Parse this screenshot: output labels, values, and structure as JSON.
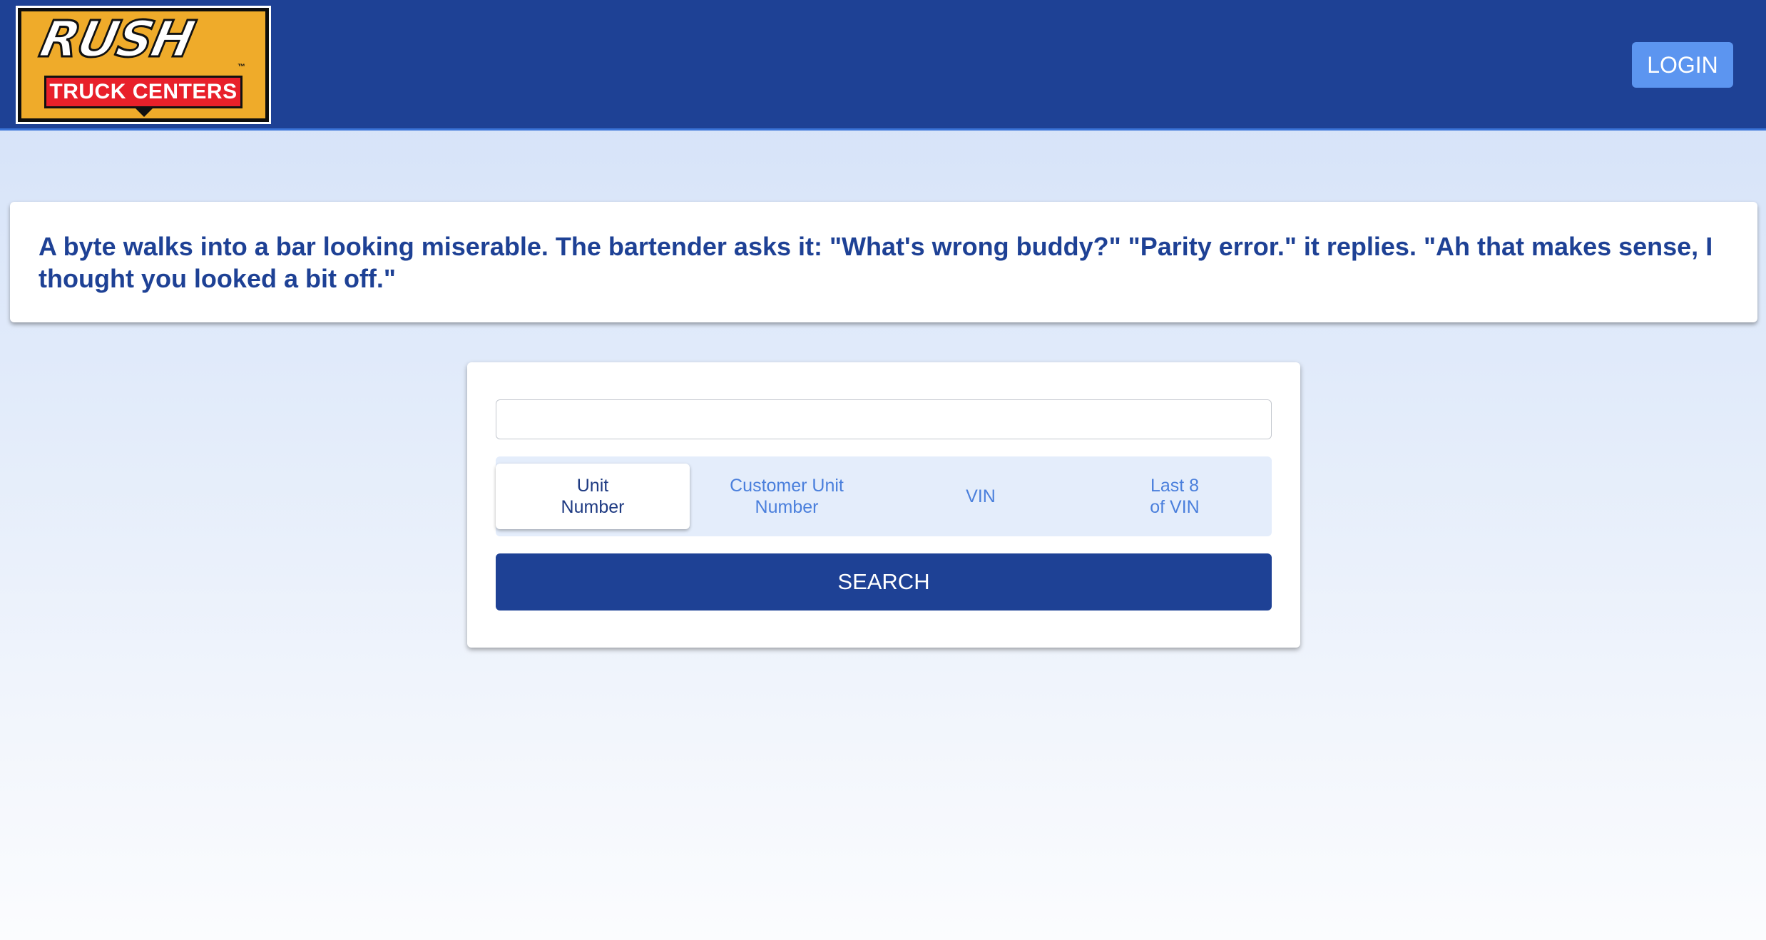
{
  "header": {
    "logo": {
      "brand_word": "RUSH",
      "trademark": "™",
      "band_text": "TRUCK CENTERS"
    },
    "login_label": "LOGIN"
  },
  "banner": {
    "text": "A byte walks into a bar looking miserable. The bartender asks it: \"What's wrong buddy?\" \"Parity error.\" it replies. \"Ah that makes sense, I thought you looked a bit off.\""
  },
  "search": {
    "input_value": "",
    "input_placeholder": "",
    "options": [
      {
        "line1": "Unit",
        "line2": "Number",
        "selected": true
      },
      {
        "line1": "Customer Unit",
        "line2": "Number",
        "selected": false
      },
      {
        "line1": "VIN",
        "line2": "",
        "selected": false
      },
      {
        "line1": "Last 8",
        "line2": "of VIN",
        "selected": false
      }
    ],
    "button_label": "SEARCH"
  },
  "colors": {
    "brand_blue": "#1e4195",
    "login_blue": "#5c95f0",
    "option_text": "#4a7fdc",
    "logo_gold": "#efab2a",
    "logo_red": "#e8202a"
  }
}
